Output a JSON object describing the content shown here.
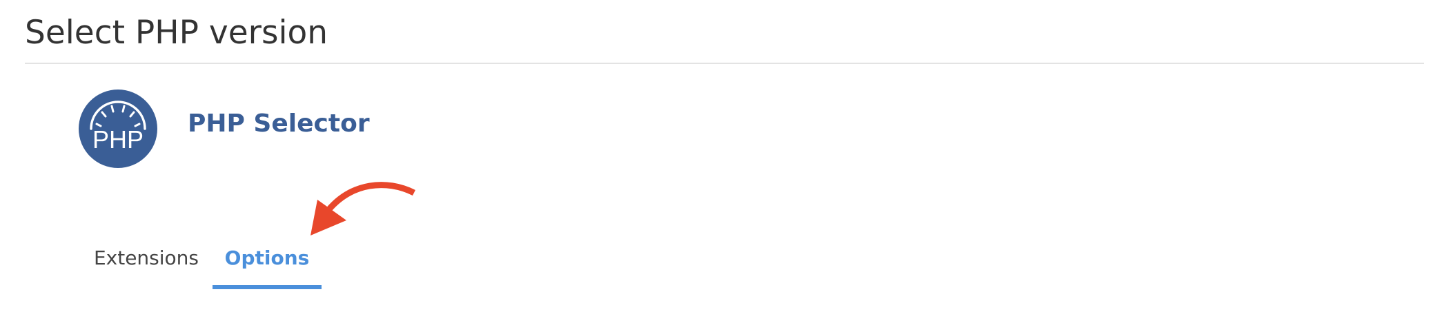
{
  "page": {
    "title": "Select PHP version"
  },
  "app": {
    "logo_icon": "php-gauge-logo-icon",
    "logo_text": "PHP",
    "name": "PHP Selector",
    "brand_color": "#3a5e96"
  },
  "tabs": [
    {
      "label": "Extensions",
      "active": false
    },
    {
      "label": "Options",
      "active": true
    }
  ],
  "annotation": {
    "icon": "red-curved-arrow-icon",
    "color": "#e8472b"
  },
  "colors": {
    "active_tab": "#4a8fdb",
    "title_text": "#333333"
  }
}
